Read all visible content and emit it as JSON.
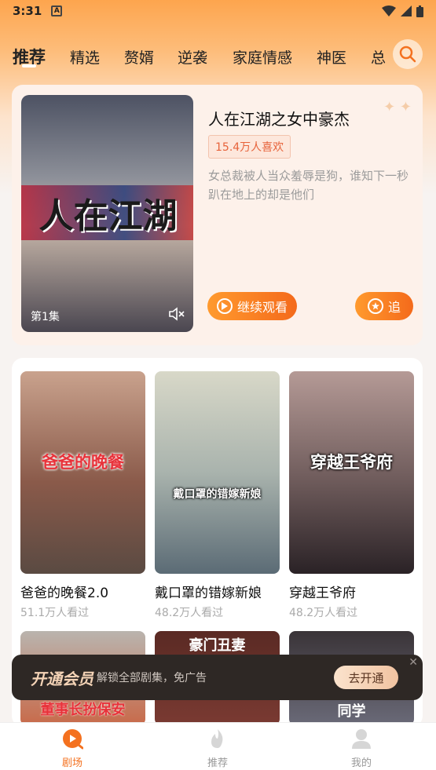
{
  "status_bar": {
    "time": "3:31",
    "notification_letter": "A"
  },
  "tabs": [
    {
      "label": "推荐",
      "active": true
    },
    {
      "label": "精选"
    },
    {
      "label": "赘婿"
    },
    {
      "label": "逆袭"
    },
    {
      "label": "家庭情感"
    },
    {
      "label": "神医"
    },
    {
      "label": "总"
    }
  ],
  "featured": {
    "title": "人在江湖之女中豪杰",
    "likes_badge": "15.4万人喜欢",
    "description": "女总裁被人当众羞辱是狗，谁知下一秒趴在地上的却是他们",
    "poster_title": "人在江湖",
    "episode_label": "第1集",
    "continue_label": "继续观看",
    "follow_label": "追"
  },
  "cards": [
    {
      "poster_title": "爸爸的晚餐",
      "name": "爸爸的晚餐2.0",
      "views": "51.1万人看过",
      "color": "#8a5a4a"
    },
    {
      "poster_title": "戴口罩的错嫁新娘",
      "name": "戴口罩的错嫁新娘",
      "views": "48.2万人看过",
      "color": "#a9b3ad"
    },
    {
      "poster_title": "穿越王爷府",
      "name": "穿越王爷府",
      "views": "48.2万人看过",
      "color": "#6d5a5a"
    }
  ],
  "row2": [
    {
      "poster_text": "董事长扮保安",
      "color": "#d85a3a"
    },
    {
      "poster_text": "豪门丑妻",
      "color": "#7a3a32"
    },
    {
      "poster_text": "同学",
      "color": "#6a6a78"
    }
  ],
  "vip": {
    "title": "开通会员",
    "desc": "解锁全部剧集，免广告",
    "button": "去开通"
  },
  "bottom_nav": [
    {
      "label": "剧场",
      "active": true
    },
    {
      "label": "推荐"
    },
    {
      "label": "我的"
    }
  ],
  "colors": {
    "accent": "#f4711f",
    "vip_bg": "#2e2825"
  }
}
